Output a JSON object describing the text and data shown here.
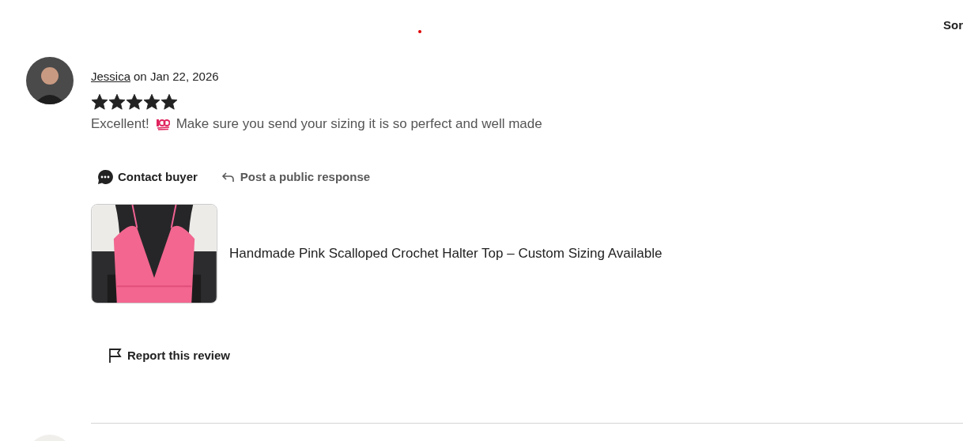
{
  "sort_label": "Sor",
  "review": {
    "reviewer": "Jessica",
    "date_text": "on Jan 22, 2026",
    "stars": 5,
    "text_before": "Excellent!",
    "text_after": "Make sure you send your sizing it is so perfect and well made",
    "actions": [
      {
        "kind": "contact",
        "label": "Contact buyer"
      },
      {
        "kind": "respond",
        "label": "Post a public response"
      }
    ],
    "item": {
      "title": "Handmade Pink Scalloped Crochet Halter Top – Custom Sizing Available"
    },
    "report": "Report this review"
  }
}
